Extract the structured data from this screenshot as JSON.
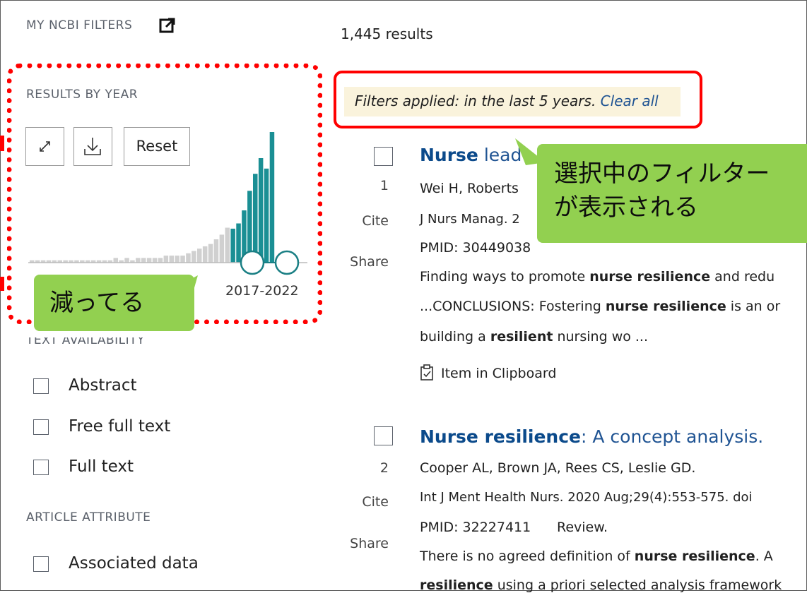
{
  "sidebar": {
    "my_ncbi_filters": "MY NCBI FILTERS",
    "results_by_year": "RESULTS BY YEAR",
    "reset_label": "Reset",
    "year_range": "2017-2022",
    "text_availability": "TEXT AVAILABILITY",
    "text_options": [
      "Abstract",
      "Free full text",
      "Full text"
    ],
    "article_attribute": "ARTICLE ATTRIBUTE",
    "attribute_options": [
      "Associated data"
    ],
    "expand_icon": "expand-icon",
    "download_icon": "download-icon",
    "external_link_icon": "external-link-icon"
  },
  "histogram": {
    "selected_color": "#1a8f94",
    "unselected_color": "#d0d0d0",
    "bar_counts_by_year_unselected_relative": [
      1,
      1,
      1,
      1,
      1,
      1,
      1,
      1,
      1,
      1,
      1,
      1,
      1,
      1,
      1,
      2,
      1,
      2,
      1,
      2,
      2,
      2,
      2,
      2,
      3,
      3,
      3,
      3,
      4,
      5,
      6,
      7,
      8,
      10,
      12,
      15
    ],
    "bar_counts_by_year_selected_relative": [
      26,
      30,
      40,
      55,
      68,
      80,
      72,
      100
    ]
  },
  "results": {
    "count": "1,445 results",
    "filters_text": "Filters applied: in the last 5 years.",
    "clear_all": "Clear all",
    "items": [
      {
        "number": "1",
        "title_bold": "Nurse",
        "title_rest": " lead",
        "authors": "Wei H, Roberts",
        "journal": "J Nurs Manag. 2",
        "pmid": "PMID: 30449038",
        "snippet1_parts": [
          "Finding ways to promote ",
          "nurse resilience",
          " and redu"
        ],
        "snippet2_parts": [
          "...CONCLUSIONS: Fostering ",
          "nurse resilience",
          " is an or"
        ],
        "snippet3_parts": [
          "building a ",
          "resilient",
          " nursing wo ..."
        ],
        "clipboard": "Item in Clipboard"
      },
      {
        "number": "2",
        "title_bold": "Nurse resilience",
        "title_rest": ": A concept analysis.",
        "authors": "Cooper AL, Brown JA, Rees CS, Leslie GD.",
        "journal": "Int J Ment Health Nurs. 2020 Aug;29(4):553-575. doi",
        "pmid": "PMID: 32227411",
        "review": "Review.",
        "snippet1_parts": [
          "There is no agreed definition of ",
          "nurse resilience",
          ". A"
        ],
        "snippet2_parts": [
          "resilience",
          " using a priori selected analysis framework"
        ]
      }
    ],
    "cite_label": "Cite",
    "share_label": "Share"
  },
  "annotations": {
    "filter_callout": "選択中のフィルター\nが表示される",
    "decrease_callout": "減ってる",
    "highlight_color": "#ff0000",
    "callout_color": "#92d050"
  }
}
